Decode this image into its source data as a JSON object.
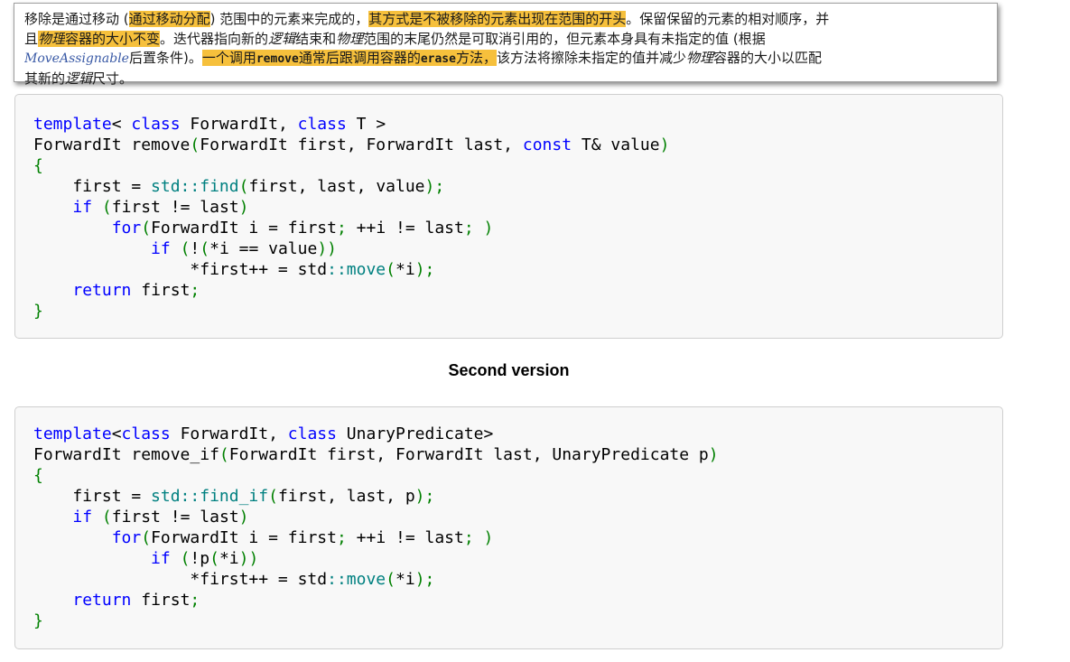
{
  "tooltip": {
    "l1_a": "移除是通过移动 (",
    "l1_hl1": "通过移动分配",
    "l1_b": ") 范围中的元素来完成的，",
    "l1_hl2": "其方式是不被移除的元素出现在范围的开头",
    "l1_c": "。保留保留的元素的相对顺序，并",
    "l2_a": "且",
    "l2_hl_it": "物理",
    "l2_hl": "容器的大小不变",
    "l2_b": "。迭代器指向新的",
    "l2_it1": "逻辑",
    "l2_c": "结束和",
    "l2_it2": "物理",
    "l2_d": "范围的末尾仍然是可取消引用的，但元素本身具有未指定的值 (根据",
    "l3_link": "MoveAssignable",
    "l3_a": "后置条件)。",
    "l3_hl_a": "一个调用",
    "l3_hl_m1": "remove",
    "l3_hl_b": "通常后跟调用容器的",
    "l3_hl_m2": "erase",
    "l3_hl_c": "方法，",
    "l3_b": "该方法将擦除未指定的值并减少",
    "l3_it": "物理",
    "l3_c": "容器的大小以匹配",
    "l4_a": "其新的",
    "l4_it": "逻辑",
    "l4_b": "尺寸。"
  },
  "code1": {
    "l1": [
      "template",
      "< ",
      "class",
      " ForwardIt, ",
      "class",
      " T >"
    ],
    "l2": [
      "ForwardIt remove",
      "(",
      "ForwardIt first, ForwardIt last, ",
      "const",
      " T& value",
      ")"
    ],
    "l3": [
      "{"
    ],
    "l4": [
      "    first = ",
      "std::",
      "find",
      "(",
      "first, last, value",
      ");"
    ],
    "l5": [
      "    ",
      "if",
      " ",
      "(",
      "first != last",
      ")"
    ],
    "l6": [
      "        ",
      "for",
      "(",
      "ForwardIt i = first",
      ";",
      " ++i != last",
      ";",
      " )"
    ],
    "l7": [
      "            ",
      "if",
      " ",
      "(",
      "!",
      "(",
      "*i == value",
      "))"
    ],
    "l8": [
      "                *first++ = std",
      "::",
      "move",
      "(",
      "*i",
      ");"
    ],
    "l9": [
      "    ",
      "return",
      " first",
      ";"
    ],
    "l10": [
      "}"
    ]
  },
  "section_title": "Second version",
  "code2": {
    "l1": [
      "template",
      "<",
      "class",
      " ForwardIt, ",
      "class",
      " UnaryPredicate>"
    ],
    "l2": [
      "ForwardIt remove_if",
      "(",
      "ForwardIt first, ForwardIt last, UnaryPredicate p",
      ")"
    ],
    "l3": [
      "{"
    ],
    "l4": [
      "    first = ",
      "std::",
      "find_if",
      "(",
      "first, last, p",
      ");"
    ],
    "l5": [
      "    ",
      "if",
      " ",
      "(",
      "first != last",
      ")"
    ],
    "l6": [
      "        ",
      "for",
      "(",
      "ForwardIt i = first",
      ";",
      " ++i != last",
      ";",
      " )"
    ],
    "l7": [
      "            ",
      "if",
      " ",
      "(",
      "!p",
      "(",
      "*i",
      "))"
    ],
    "l8": [
      "                *first++ = std",
      "::",
      "move",
      "(",
      "*i",
      ");"
    ],
    "l9": [
      "    ",
      "return",
      " first",
      ";"
    ],
    "l10": [
      "}"
    ]
  },
  "colors": {
    "highlight": "#f6c03c",
    "keyword": "#0000ff",
    "brace": "#008000",
    "namespace": "#008080",
    "link": "#3a5aa6"
  }
}
